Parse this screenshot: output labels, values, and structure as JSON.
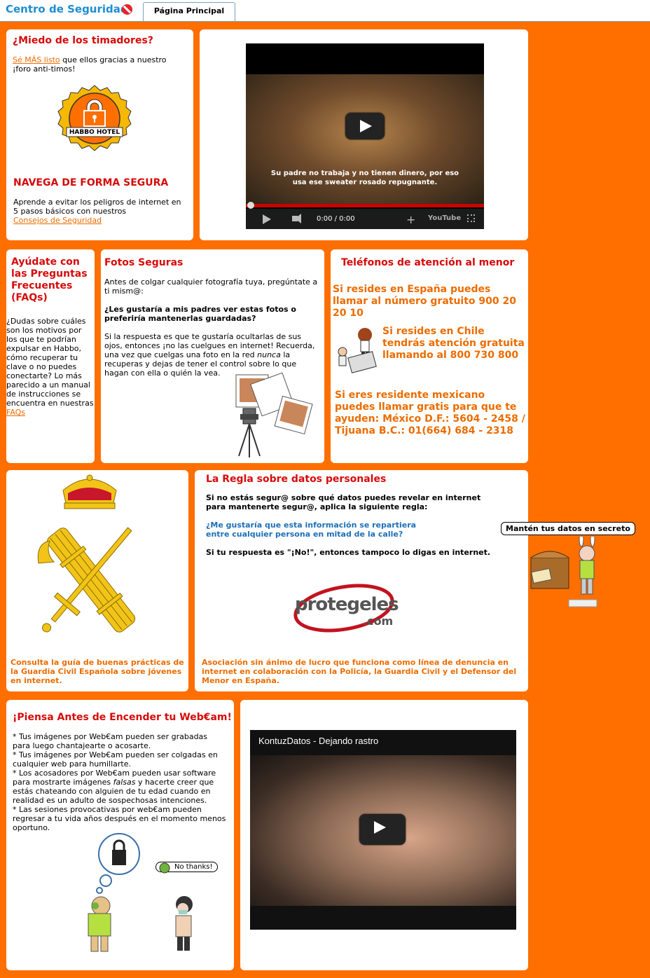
{
  "header": {
    "site_title": "Centro de Seguridad",
    "tab_label": "Página Principal"
  },
  "scammers": {
    "title": "¿Miedo de los timadores?",
    "link": "Sé MÁS listo",
    "text": " que ellos gracias a nuestro ¡foro anti-timos!",
    "badge_text": "HABBO HOTEL",
    "nav_title": "NAVEGA DE FORMA SEGURA",
    "nav_text": "Aprende a evitar los peligros de internet en 5 pasos básicos con nuestros",
    "nav_link": "Consejos de Seguridad"
  },
  "video1": {
    "subtitle_line1": "Su padre no trabaja y no tienen dinero, por eso",
    "subtitle_line2": "usa ese sweater rosado repugnante.",
    "time": "0:00 / 0:00",
    "brand": "YouTube"
  },
  "faq": {
    "title": "Ayúdate con las Preguntas Frecuentes (FAQs)",
    "text": "¿Dudas sobre cuáles son los motivos por los que te podrían expulsar en Habbo, cómo recuperar tu clave o no puedes conectarte? Lo más parecido a un manual de instrucciones se encuentra en nuestras",
    "link": "FAQs"
  },
  "photos": {
    "title": "Fotos Seguras",
    "intro": "Antes de colgar cualquier fotografía tuya, pregúntate a ti mism@:",
    "question": "¿Les gustaría a mis padres ver estas fotos o preferiría mantenerlas guardadas?",
    "text_before": "Si la respuesta es que te gustaría ocultarlas de sus ojos, entonces ¡no las cuelgues en internet! Recuerda, una vez que cuelgas una foto en la red ",
    "text_em": "nunca",
    "text_after": " la recuperas y dejas de tener el control sobre lo que hagan con ella o quién la vea."
  },
  "phones": {
    "title": "Teléfonos de atención al menor",
    "spain": "Si resides en España puedes llamar al número gratuito 900 20 20 10",
    "chile": "Si resides en Chile tendrás atención gratuita llamando al 800 730 800",
    "mexico": "Si eres residente mexicano puedes llamar gratis para que te ayuden: México D.F.: 5604 - 2458 / Tijuana B.C.: 01(664) 684 - 2318"
  },
  "guardia": {
    "caption": "Consulta la guía de buenas prácticas de la Guardia Civil Española sobre jóvenes en internet."
  },
  "rule": {
    "title": "La Regla sobre datos personales",
    "intro": "Si no estás segur@ sobre qué datos puedes revelar en internet para mantenerte segur@, aplica la siguiente regla:",
    "question": "¿Me gustaría que esta información se repartiera entre cualquier persona en mitad de la calle?",
    "answer": "Si tu respuesta es \"¡No!\", entonces tampoco lo digas en internet.",
    "logo_main": "protegeles",
    "logo_sub": ".com",
    "caption": "Asociación sin ánimo de lucro que funciona como línea de denuncia en internet en colaboración con la Policía, la Guardia Civil y el Defensor del Menor en España.",
    "bubble": "Mantén tus datos en secreto"
  },
  "webcam": {
    "title": "¡Piensa Antes de Encender tu Web€am!",
    "items": [
      "* Tus imágenes por Web€am pueden ser grabadas para luego chantajearte o acosarte.",
      "* Tus imágenes por Web€am pueden ser colgadas en cualquier web para humillarte.",
      "* Los acosadores por Web€am pueden usar software para mostrarte imágenes ",
      "* Las sesiones provocativas por web€am pueden regresar a tu vida años después en el momento menos oportuno."
    ],
    "item3_em": "falsas",
    "item3_rest": " y hacerte creer que estás chateando con alguien de tu edad cuando en realidad es un adulto de sospechosas intenciones.",
    "bubble": "No thanks!"
  },
  "video2": {
    "title": "KontuzDatos - Dejando rastro"
  },
  "colors": {
    "orange": "#ff6f00",
    "red": "#d80a0a",
    "link_orange": "#ec6c00",
    "blue": "#1d8ed0"
  }
}
